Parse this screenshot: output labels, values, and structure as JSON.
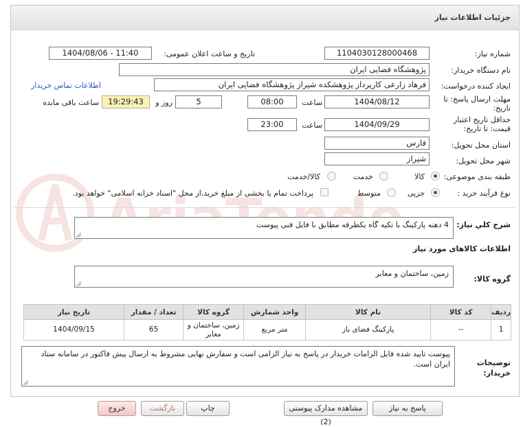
{
  "header": {
    "title": "جزئیات اطلاعات نیاز"
  },
  "fields": {
    "need_number_label": "شماره نیاز:",
    "need_number": "1104030128000468",
    "announce_label": "تاریخ و ساعت اعلان عمومی:",
    "announce_value": "1404/08/06 - 11:40",
    "buyer_org_label": "نام دستگاه خریدار:",
    "buyer_org": "پژوهشگاه فضایی ایران",
    "creator_label": "ایجاد کننده درخواست:",
    "creator": "فرهاد زارعی کارپرداز پژوهشکده شیراز پژوهشگاه فضایی ایران",
    "contact_link": "اطلاعات تماس خریدار",
    "deadline_label_1": "مهلت ارسال پاسخ: تا",
    "deadline_label_2": "تاریخ:",
    "deadline_date": "1404/08/12",
    "time_label": "ساعت",
    "deadline_time": "08:00",
    "days_value": "5",
    "days_label": "روز و",
    "remaining_time": "19:29:43",
    "remaining_label": "ساعت باقی مانده",
    "validity_label_1": "حداقل تاریخ اعتبار",
    "validity_label_2": "قیمت: تا تاریخ:",
    "validity_date": "1404/09/29",
    "validity_time": "23:00",
    "province_label": "استان محل تحویل:",
    "province": "فارس",
    "city_label": "شهر محل تحویل:",
    "city": "شیراز",
    "category_label": "طبقه بندی موضوعی:",
    "category_options": [
      "کالا",
      "خدمت",
      "کالا/خدمت"
    ],
    "category_selected": 0,
    "process_label": "نوع فرآیند خرید :",
    "process_options": [
      "جزیی",
      "متوسط"
    ],
    "process_selected": 0,
    "payment_note": "پرداخت تمام یا بخشی از مبلغ خرید،از محل \"اسناد خزانه اسلامی\" خواهد بود."
  },
  "description": {
    "label": "شرح کلي نياز:",
    "value": "4 دهنه پارکینگ با تکیه گاه یکطرفه مطابق با فایل فنی پیوست"
  },
  "goods_section": {
    "title": "اطلاعات کالاهای مورد نیاز",
    "group_label": "گروه کالا:",
    "group_value": "زمین، ساختمان و معابر"
  },
  "table": {
    "headers": [
      "ردیف",
      "کد کالا",
      "نام کالا",
      "واحد شمارش",
      "گروه کالا",
      "تعداد / مقدار",
      "تاریخ نیاز"
    ],
    "rows": [
      [
        "1",
        "--",
        "پارکینگ فضای باز",
        "متر مربع",
        "زمین، ساختمان و معابر",
        "65",
        "1404/09/15"
      ]
    ]
  },
  "buyer_notes": {
    "label_1": "توضیحات",
    "label_2": "خریدار:",
    "value": "پیوست تایید شده فایل الزامات خریدار در پاسخ به نیاز الزامی است و سفارش نهایی مشروط به ارسال پیش فاکتور در سامانه ستاد ایران است."
  },
  "buttons": {
    "reply": "پاسخ به نیاز",
    "attachments": "مشاهده مدارک پیوستی (2)",
    "print": "چاپ",
    "back": "بازگشت",
    "exit": "خروج"
  },
  "watermark": {
    "text": "AriaTender.neT"
  },
  "colors": {
    "link": "#2b55c8",
    "remaining_bg": "#fbf1b7",
    "header_bg": "#e8e8e8"
  }
}
